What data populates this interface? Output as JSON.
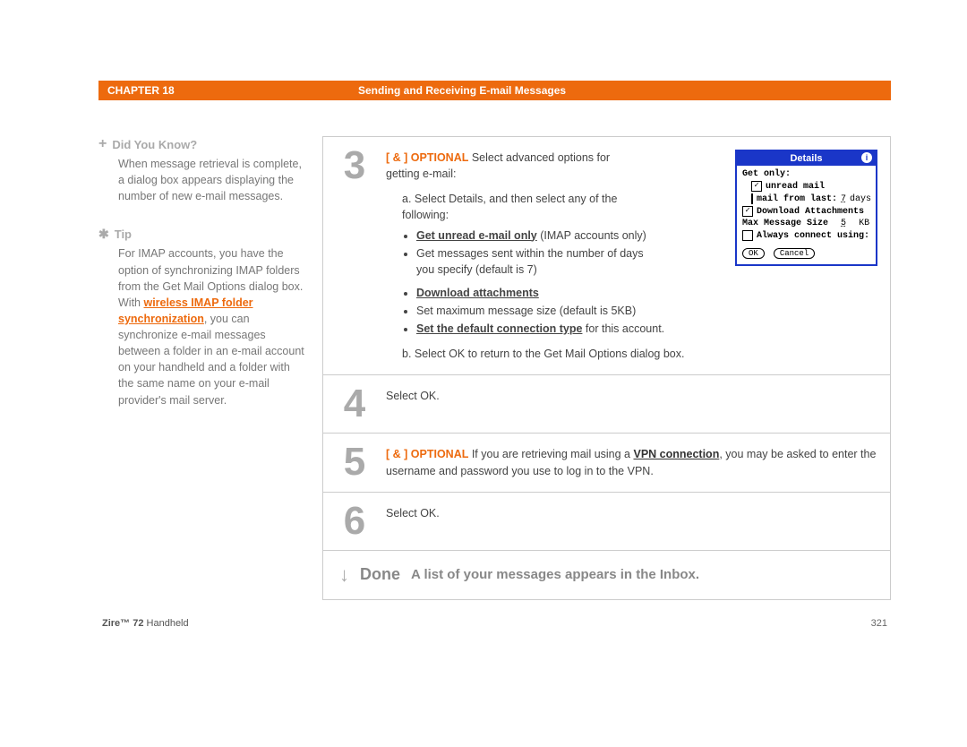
{
  "header": {
    "chapter": "CHAPTER 18",
    "title": "Sending and Receiving E-mail Messages"
  },
  "sidebar": {
    "didyouknow": {
      "head": "Did You Know?",
      "text": "When message retrieval is complete, a dialog box appears displaying the number of new e-mail messages."
    },
    "tip": {
      "head": "Tip",
      "pre": "For IMAP accounts, you have the option of synchronizing IMAP folders from the Get Mail Options dialog box. With ",
      "link": "wireless IMAP folder synchronization",
      "post": ", you can synchronize e-mail messages between a folder in an e-mail account on your handheld and a folder with the same name on your e-mail provider's mail server."
    }
  },
  "steps": {
    "s3": {
      "num": "3",
      "opt": "[ & ] OPTIONAL",
      "lead": "   Select advanced options for getting e-mail:",
      "a_pre": "a.  Select Details, and then select any of the following:",
      "bul1_a": "Get unread e-mail only",
      "bul1_b": " (IMAP accounts only)",
      "bul2": "Get messages sent within the number of days you specify (default is 7)",
      "bul3": "Download attachments",
      "bul4": "Set maximum message size (default is 5KB)",
      "bul5_a": "Set the default connection type",
      "bul5_b": " for this account.",
      "b": "b.  Select OK to return to the Get Mail Options dialog box."
    },
    "s4": {
      "num": "4",
      "text": "Select OK."
    },
    "s5": {
      "num": "5",
      "opt": "[ & ] OPTIONAL",
      "text1": "   If you are retrieving mail using a ",
      "vpn": "VPN connection",
      "text2": ", you may be asked to enter the username and password you use to log in to the VPN."
    },
    "s6": {
      "num": "6",
      "text": "Select OK."
    }
  },
  "done": {
    "arrow": "↓",
    "label": "Done",
    "text": "A list of your messages appears in the Inbox."
  },
  "details": {
    "title": "Details",
    "getonly": "Get only:",
    "unread": "unread mail",
    "mailfrom_a": "mail from last:",
    "mailfrom_days": "7",
    "mailfrom_b": "days",
    "dl": "Download Attachments",
    "maxsize_a": "Max Message Size",
    "maxsize_val": "5",
    "maxsize_b": "KB",
    "always": "Always connect using:",
    "ok": "OK",
    "cancel": "Cancel"
  },
  "footer": {
    "product_a": "Zire™ 72",
    "product_b": " Handheld",
    "page": "321"
  }
}
